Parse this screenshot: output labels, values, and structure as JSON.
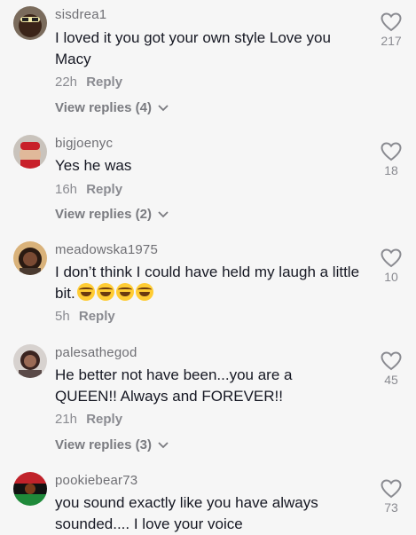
{
  "comments": [
    {
      "username": "sisdrea1",
      "text": "I loved it you got your own style Love you Macy",
      "time": "22h",
      "reply_label": "Reply",
      "view_replies": "View replies (4)",
      "likes": "217"
    },
    {
      "username": "bigjoenyc",
      "text": "Yes he was",
      "time": "16h",
      "reply_label": "Reply",
      "view_replies": "View replies (2)",
      "likes": "18"
    },
    {
      "username": "meadowska1975",
      "text": "I don’t think I could have held my laugh a little bit.",
      "emoji": [
        "face-with-tears-of-joy",
        "face-with-tears-of-joy",
        "face-with-tears-of-joy",
        "face-with-tears-of-joy"
      ],
      "time": "5h",
      "reply_label": "Reply",
      "likes": "10"
    },
    {
      "username": "palesathegod",
      "text": "He better not have been...you are a QUEEN!! Always and FOREVER!!",
      "time": "21h",
      "reply_label": "Reply",
      "view_replies": "View replies (3)",
      "likes": "45"
    },
    {
      "username": "pookiebear73",
      "text": "you sound exactly like you have always sounded.... I love your voice",
      "likes": "73"
    }
  ],
  "icons": {
    "like": "heart-outline-icon",
    "expand": "chevron-down-icon"
  },
  "colors": {
    "background": "#f6f6f6",
    "text": "#161823",
    "muted": "#8a8b91"
  }
}
